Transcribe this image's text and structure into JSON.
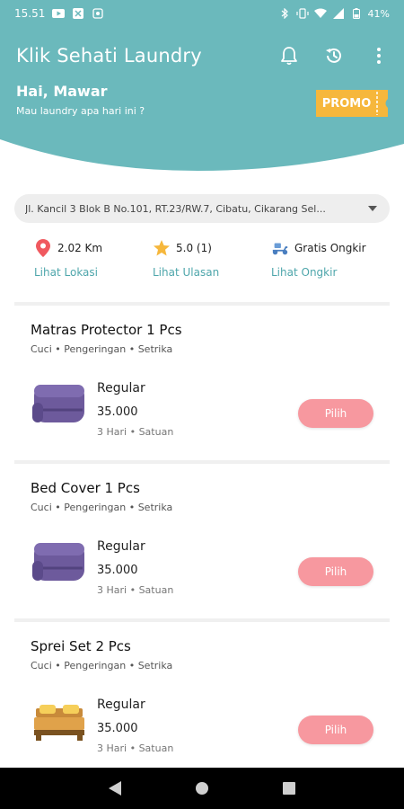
{
  "status_bar": {
    "time": "15.51",
    "battery": "41%"
  },
  "app": {
    "title": "Klik Sehati Laundry"
  },
  "greeting": {
    "name": "Hai, Mawar",
    "subtitle": "Mau laundry apa hari ini ?"
  },
  "promo": {
    "label": "PROMO"
  },
  "address": {
    "text": "Jl. Kancil 3 Blok B No.101, RT.23/RW.7, Cibatu, Cikarang Sel..."
  },
  "info": {
    "distance": "2.02 Km",
    "distance_link": "Lihat Lokasi",
    "rating": "5.0 (1)",
    "rating_link": "Lihat Ulasan",
    "shipping": "Gratis Ongkir",
    "shipping_link": "Lihat Ongkir"
  },
  "colors": {
    "header_teal": "#6bb9bc",
    "accent_teal": "#4ea6ab",
    "promo_yellow": "#f6b73c",
    "button_pink": "#f7989f",
    "item_purple": "#6d5a9c"
  },
  "items": [
    {
      "title": "Matras Protector 1 Pcs",
      "services": "Cuci • Pengeringan • Setrika",
      "plan": "Regular",
      "price": "35.000",
      "meta": "3 Hari • Satuan",
      "button": "Pilih",
      "icon": "folded-cloth-icon"
    },
    {
      "title": "Bed Cover 1 Pcs",
      "services": "Cuci • Pengeringan • Setrika",
      "plan": "Regular",
      "price": "35.000",
      "meta": "3 Hari • Satuan",
      "button": "Pilih",
      "icon": "folded-cloth-icon"
    },
    {
      "title": "Sprei Set 2 Pcs",
      "services": "Cuci • Pengeringan • Setrika",
      "plan": "Regular",
      "price": "35.000",
      "meta": "3 Hari • Satuan",
      "button": "Pilih",
      "icon": "bed-icon"
    }
  ]
}
